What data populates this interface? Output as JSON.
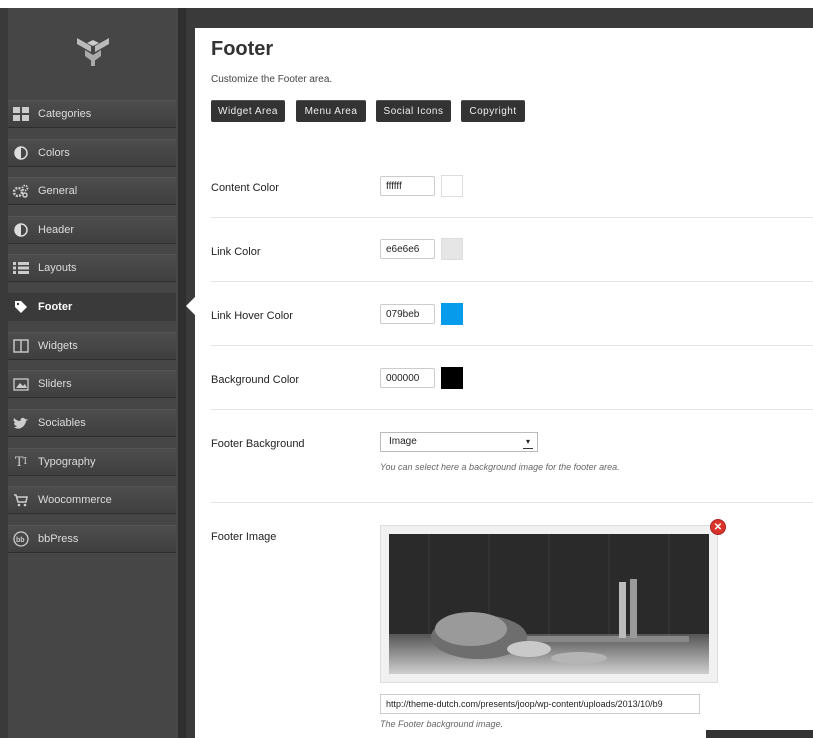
{
  "sidebar": {
    "items": [
      {
        "label": "Categories",
        "icon": "categories-icon"
      },
      {
        "label": "Colors",
        "icon": "colors-icon"
      },
      {
        "label": "General",
        "icon": "gears-icon"
      },
      {
        "label": "Header",
        "icon": "header-icon"
      },
      {
        "label": "Layouts",
        "icon": "layouts-icon"
      },
      {
        "label": "Footer",
        "icon": "tag-icon"
      },
      {
        "label": "Widgets",
        "icon": "widgets-icon"
      },
      {
        "label": "Sliders",
        "icon": "image-icon"
      },
      {
        "label": "Sociables",
        "icon": "twitter-bird-icon"
      },
      {
        "label": "Typography",
        "icon": "typography-icon"
      },
      {
        "label": "Woocommerce",
        "icon": "cart-icon"
      },
      {
        "label": "bbPress",
        "icon": "bbpress-icon"
      }
    ],
    "active": "Footer"
  },
  "page": {
    "title": "Footer",
    "subtitle": "Customize the Footer area."
  },
  "tabs": [
    "Widget Area",
    "Menu Area",
    "Social Icons",
    "Copyright"
  ],
  "fields": {
    "content_color": {
      "label": "Content Color",
      "value": "ffffff",
      "swatch": "#ffffff"
    },
    "link_color": {
      "label": "Link Color",
      "value": "e6e6e6",
      "swatch": "#e6e6e6"
    },
    "link_hover_color": {
      "label": "Link Hover Color",
      "value": "079beb",
      "swatch": "#079beb"
    },
    "background_color": {
      "label": "Background Color",
      "value": "000000",
      "swatch": "#000000"
    },
    "footer_background": {
      "label": "Footer Background",
      "value": "Image",
      "help": "You can select here a background image for the footer area."
    },
    "footer_image": {
      "label": "Footer Image",
      "url": "http://theme-dutch.com/presents/joop/wp-content/uploads/2013/10/b9",
      "help": "The Footer background image."
    }
  }
}
